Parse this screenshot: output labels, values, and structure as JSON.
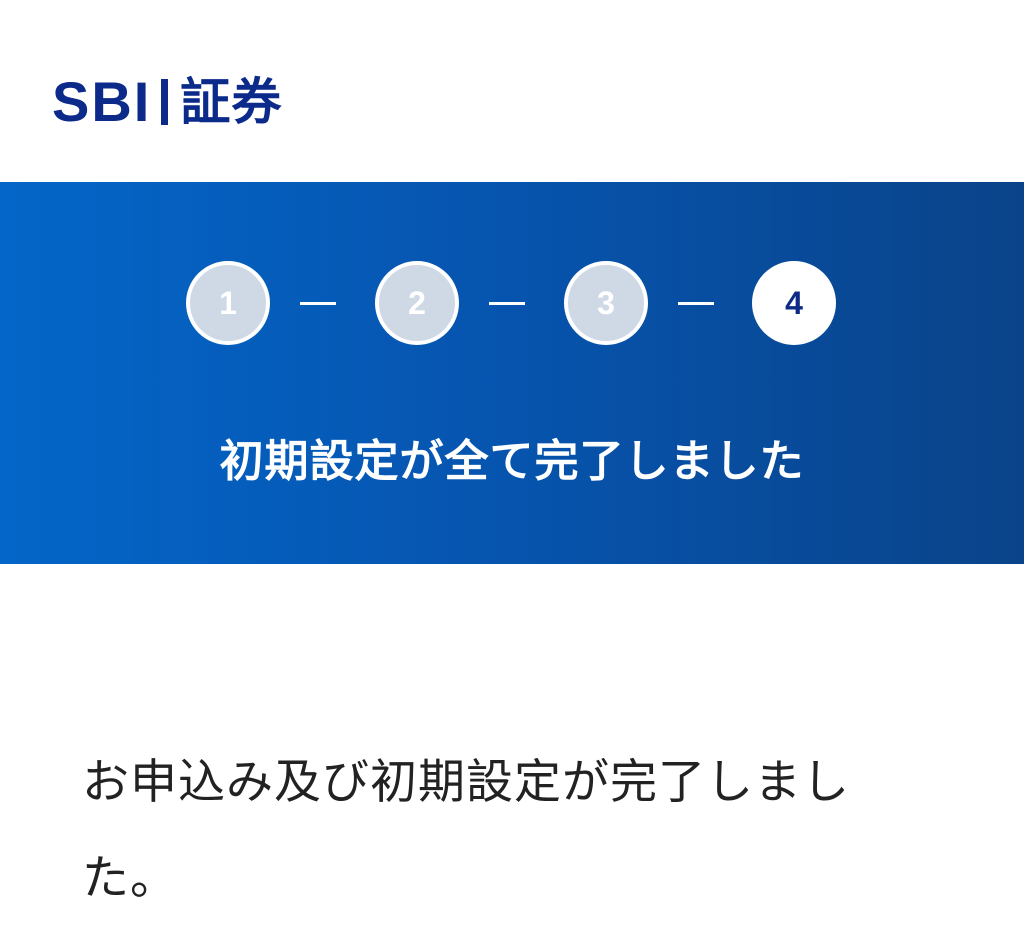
{
  "header": {
    "logo": {
      "latin": "SBI",
      "kanji": "証券"
    }
  },
  "banner": {
    "steps": [
      {
        "number": "1",
        "state": "completed"
      },
      {
        "number": "2",
        "state": "completed"
      },
      {
        "number": "3",
        "state": "completed"
      },
      {
        "number": "4",
        "state": "current"
      }
    ],
    "title": "初期設定が全て完了しました"
  },
  "main": {
    "message": "お申込み及び初期設定が完了しました。"
  },
  "colors": {
    "brand_navy": "#0b2a8a",
    "banner_start": "#0466c8",
    "banner_end": "#0a4389",
    "step_completed_fill": "#cfd9e6",
    "step_current_text": "#0c2a86"
  }
}
